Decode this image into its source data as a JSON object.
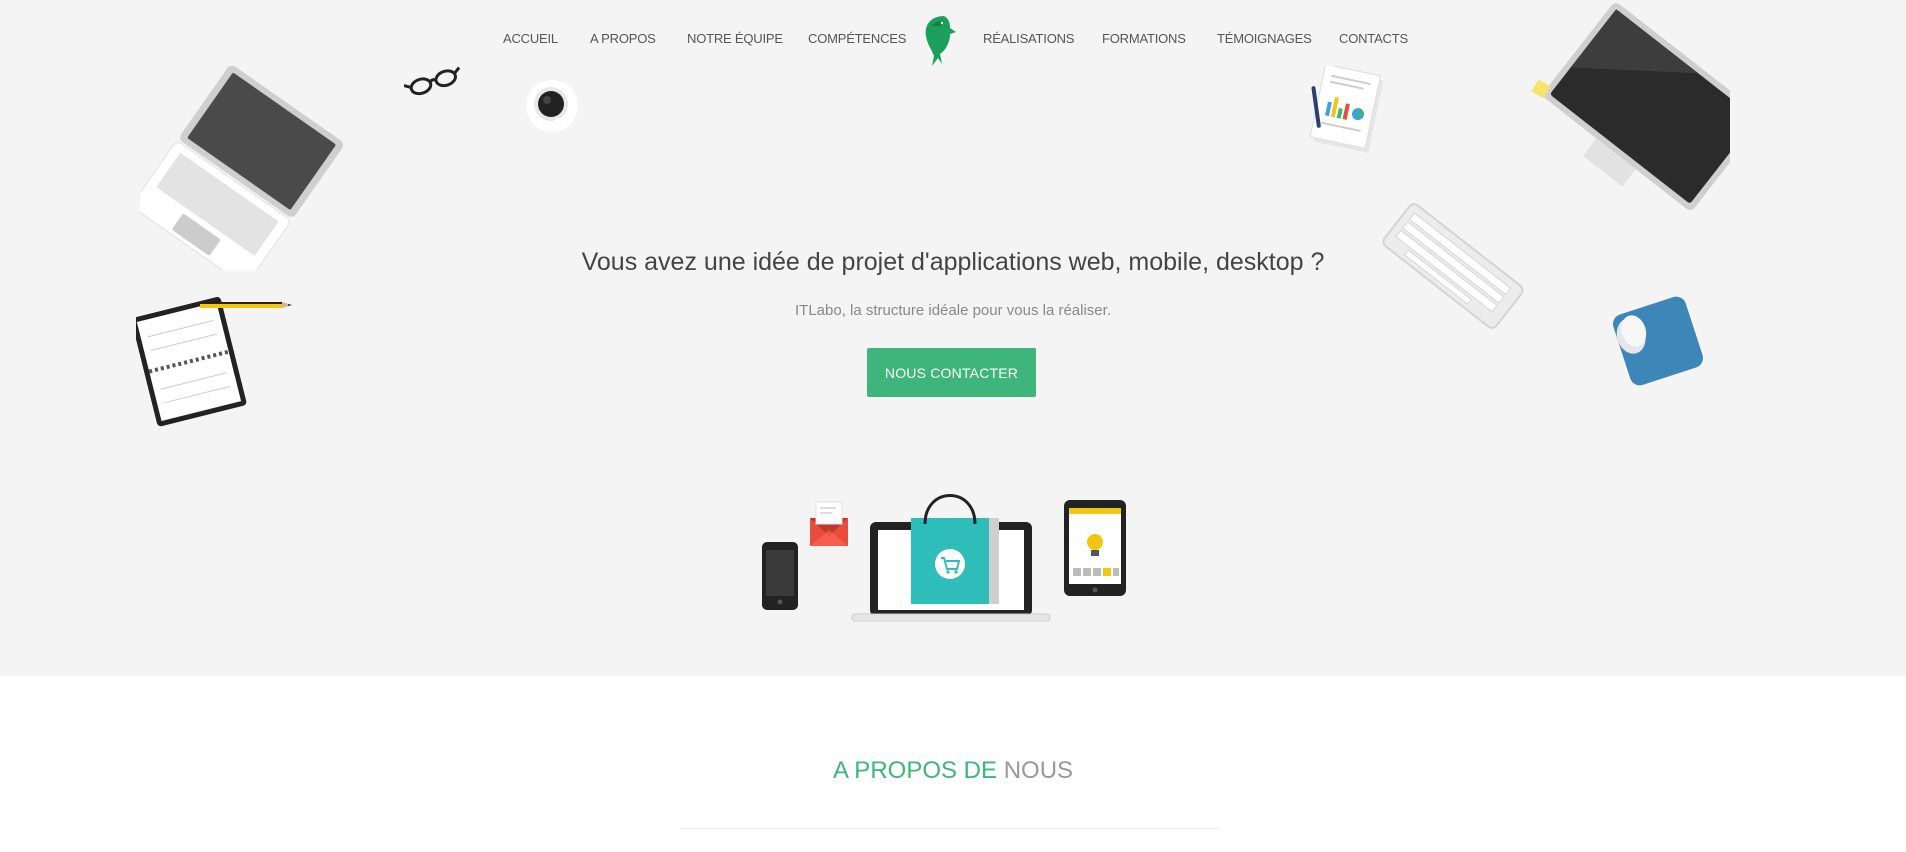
{
  "nav": {
    "items": [
      {
        "label": "ACCUEIL"
      },
      {
        "label": "A PROPOS"
      },
      {
        "label": "NOTRE ÉQUIPE"
      },
      {
        "label": "COMPÉTENCES"
      },
      {
        "label": "RÉALISATIONS"
      },
      {
        "label": "FORMATIONS"
      },
      {
        "label": "TÉMOIGNAGES"
      },
      {
        "label": "CONTACTS"
      }
    ],
    "logo_icon": "dolphin-logo-icon"
  },
  "hero": {
    "title": "Vous avez une idée de projet d'applications web, mobile, desktop ?",
    "subtitle": "ITLabo, la structure idéale pour vous la réaliser.",
    "cta_label": "NOUS CONTACTER"
  },
  "about": {
    "title_part1": "A PROPOS DE",
    "title_part2": "NOUS"
  },
  "colors": {
    "accent": "#3eb57a",
    "hero_bg": "#f4f4f4",
    "text_dark": "#444444",
    "text_muted": "#888888"
  }
}
